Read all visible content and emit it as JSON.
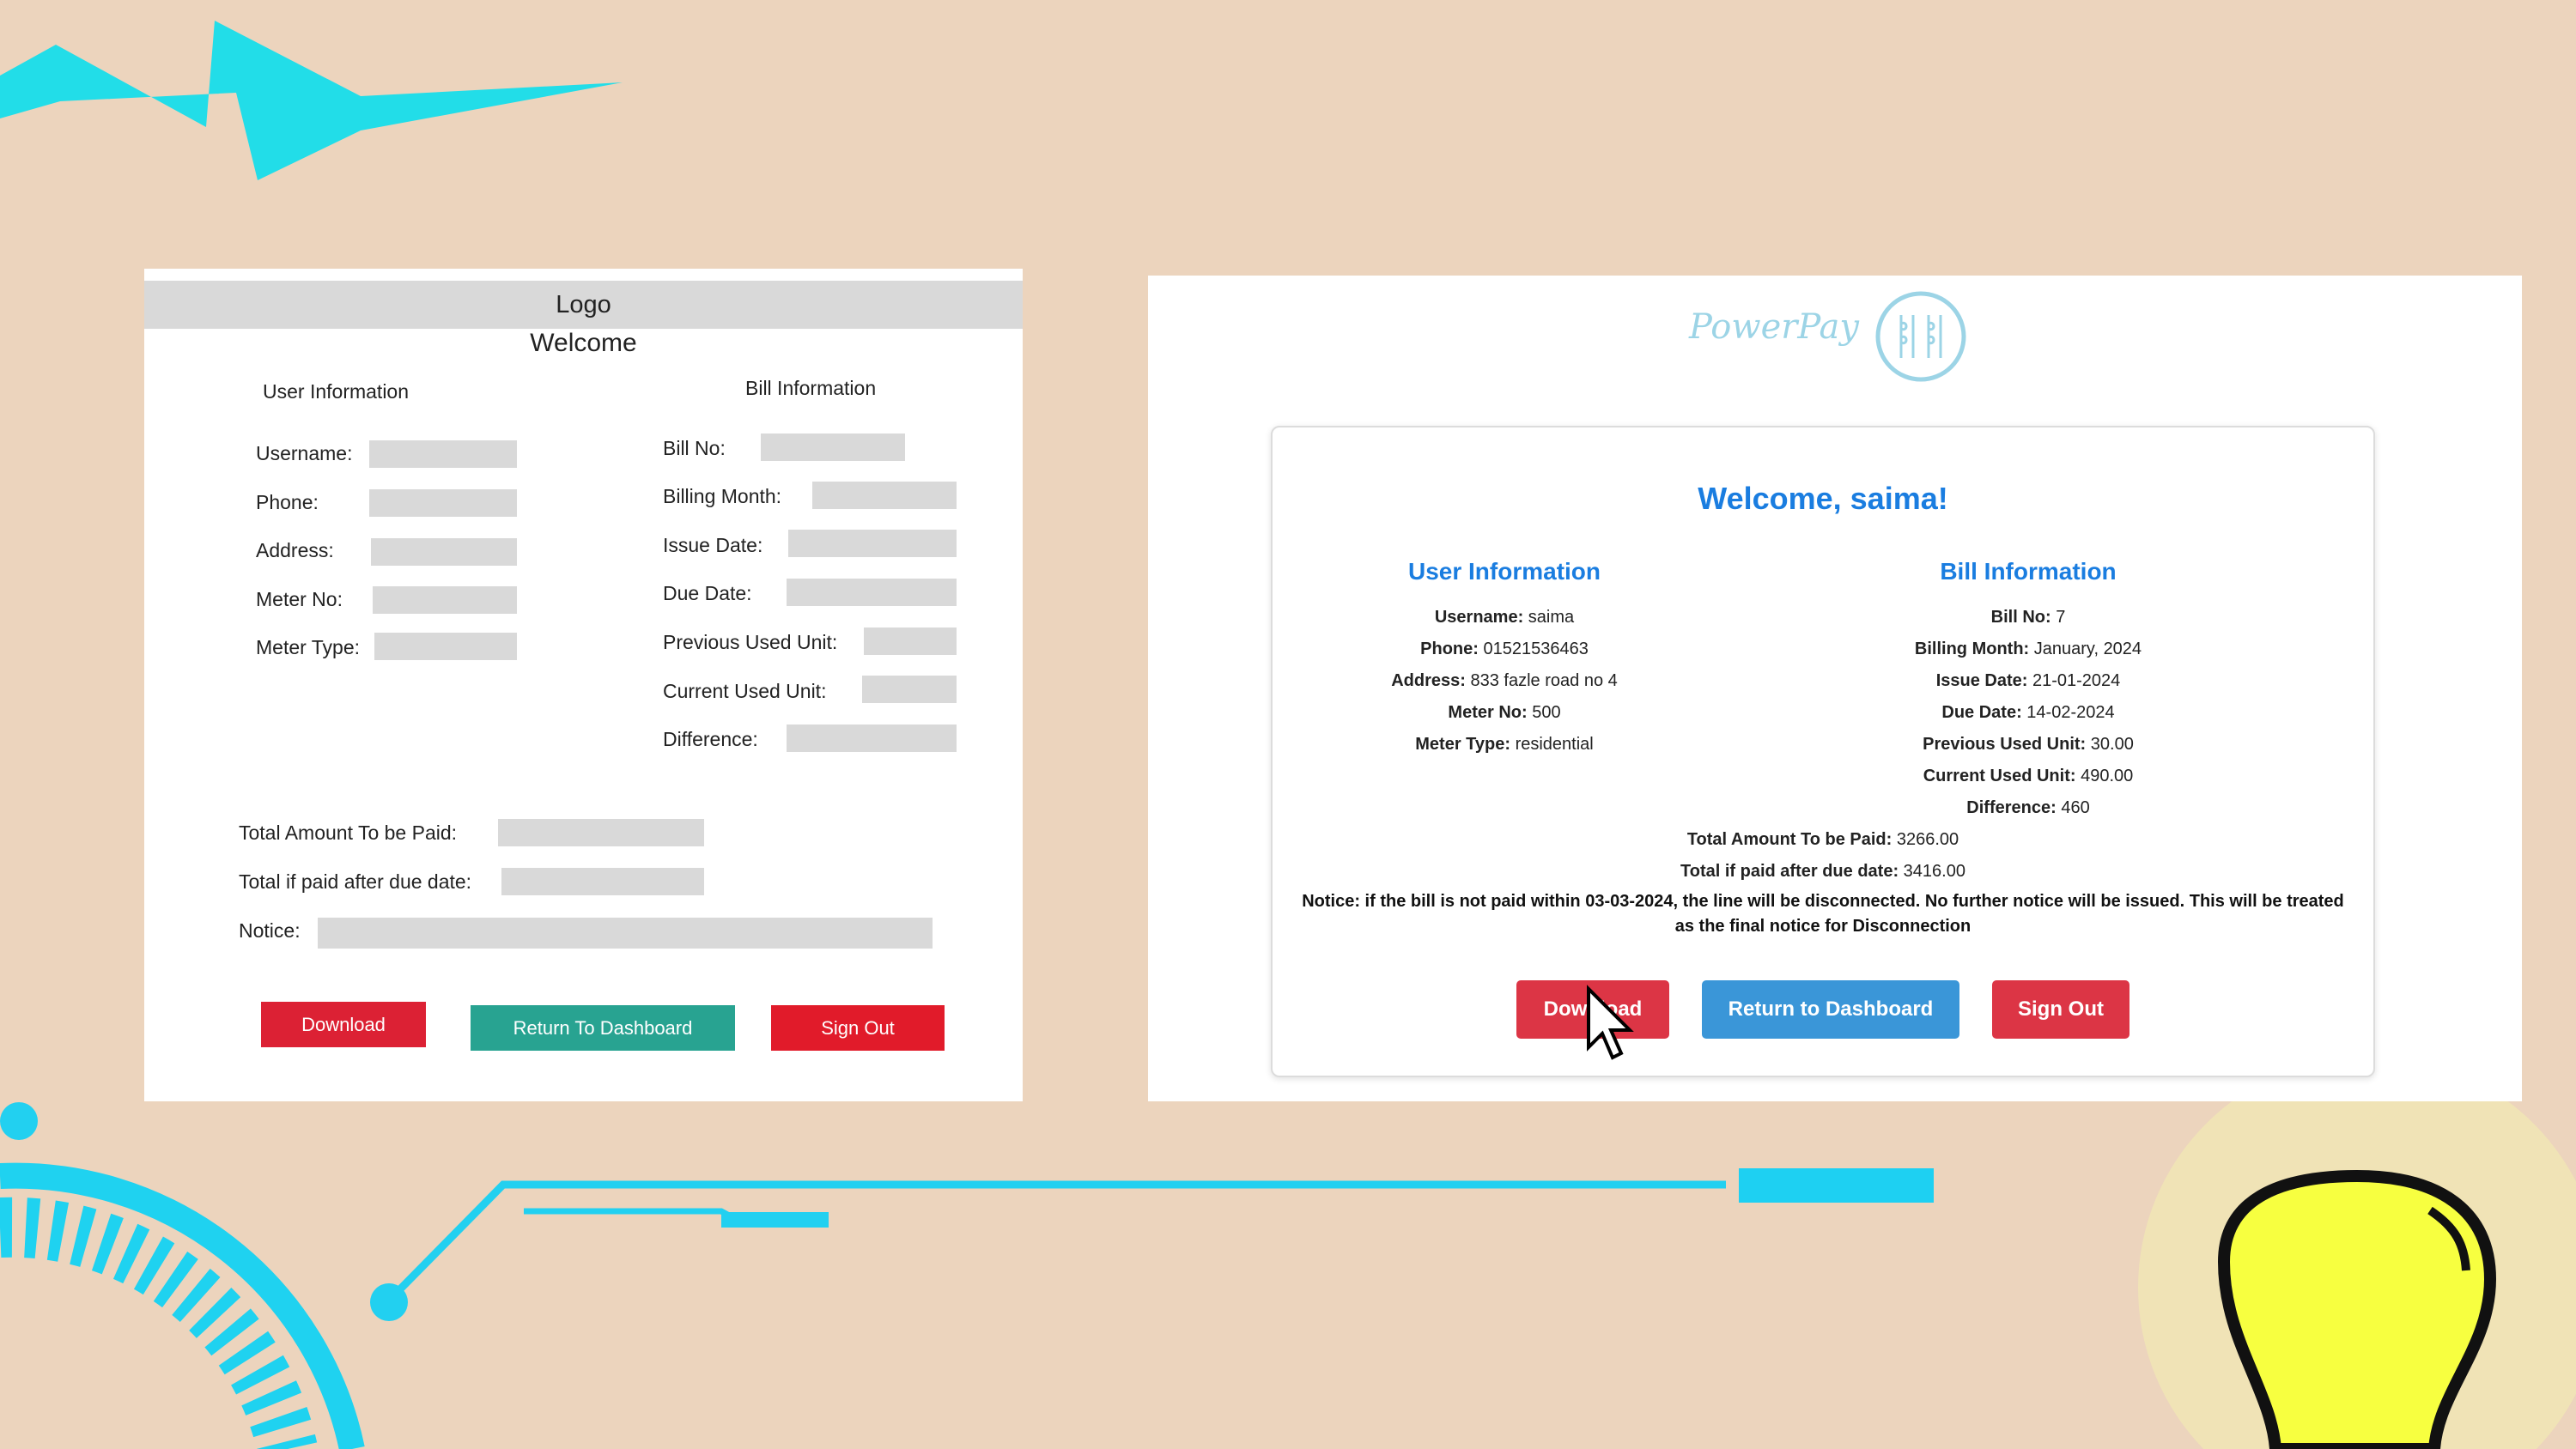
{
  "wireframe": {
    "logo": "Logo",
    "welcome": "Welcome",
    "user_info_heading": "User Information",
    "bill_info_heading": "Bill Information",
    "user_fields": [
      "Username:",
      "Phone:",
      "Address:",
      "Meter No:",
      "Meter Type:"
    ],
    "bill_fields": [
      "Bill No:",
      "Billing Month:",
      "Issue Date:",
      "Due Date:",
      "Previous Used Unit:",
      "Current Used Unit:",
      "Difference:"
    ],
    "total_label": "Total Amount To be Paid:",
    "after_due_label": "Total if paid after due date:",
    "notice_label": "Notice:",
    "buttons": {
      "download": "Download",
      "dashboard": "Return To Dashboard",
      "signout": "Sign Out"
    },
    "colors": {
      "download": "#dc2134",
      "dashboard": "#28a391",
      "signout": "#e11b2a"
    }
  },
  "app": {
    "brand": "PowerPay",
    "welcome": "Welcome, saima!",
    "user_info_heading": "User Information",
    "bill_info_heading": "Bill Information",
    "user_info": [
      {
        "label": "Username:",
        "value": "saima"
      },
      {
        "label": "Phone:",
        "value": "01521536463"
      },
      {
        "label": "Address:",
        "value": "833 fazle road no 4"
      },
      {
        "label": "Meter No:",
        "value": "500"
      },
      {
        "label": "Meter Type:",
        "value": "residential"
      }
    ],
    "bill_info": [
      {
        "label": "Bill No:",
        "value": "7"
      },
      {
        "label": "Billing Month:",
        "value": "January, 2024"
      },
      {
        "label": "Issue Date:",
        "value": "21-01-2024"
      },
      {
        "label": "Due Date:",
        "value": "14-02-2024"
      },
      {
        "label": "Previous Used Unit:",
        "value": "30.00"
      },
      {
        "label": "Current Used Unit:",
        "value": "490.00"
      },
      {
        "label": "Difference:",
        "value": "460"
      }
    ],
    "total": {
      "label": "Total Amount To be Paid:",
      "value": "3266.00"
    },
    "after_due": {
      "label": "Total if paid after due date:",
      "value": "3416.00"
    },
    "notice": "Notice: if the bill is not paid within 03-03-2024, the line will be disconnected. No further notice will be issued. This will be treated as the final notice for Disconnection",
    "buttons": {
      "download": "Download",
      "dashboard": "Return to Dashboard",
      "signout": "Sign Out"
    },
    "colors": {
      "accent": "#1a7de0",
      "download": "#dc3545",
      "dashboard": "#3a96d8",
      "signout": "#dc3545",
      "brand": "#9cd4e6"
    }
  }
}
